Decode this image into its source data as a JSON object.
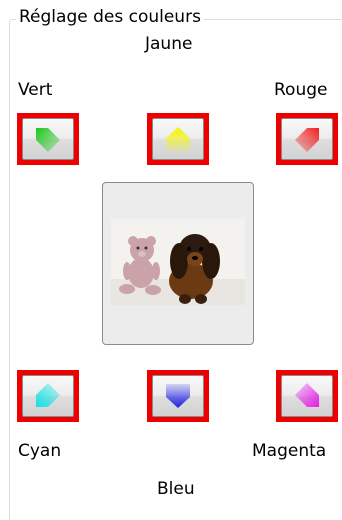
{
  "group_title": "Réglage des couleurs",
  "labels": {
    "yellow": "Jaune",
    "green": "Vert",
    "red": "Rouge",
    "cyan": "Cyan",
    "blue": "Bleu",
    "magenta": "Magenta"
  },
  "buttons": [
    {
      "name": "green",
      "color": "#19c619"
    },
    {
      "name": "yellow",
      "color": "#f4f400"
    },
    {
      "name": "red",
      "color": "#f01e1e"
    },
    {
      "name": "cyan",
      "color": "#10e3e3"
    },
    {
      "name": "blue",
      "color": "#1e1ee6"
    },
    {
      "name": "magenta",
      "color": "#e61ee6"
    }
  ],
  "highlight_color": "#ee0000",
  "preview": {
    "subject": "teddy bear and dachshund puppy photo"
  }
}
